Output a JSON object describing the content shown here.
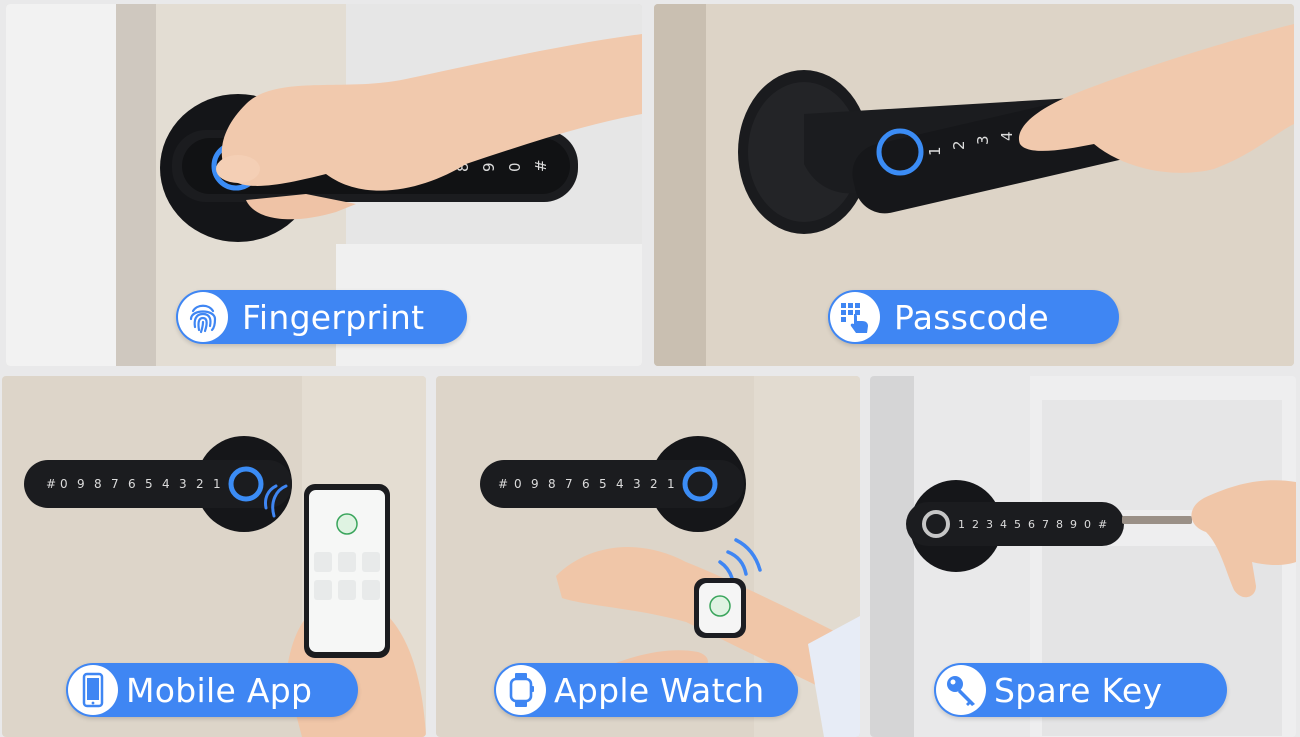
{
  "features": [
    {
      "label": "Fingerprint",
      "icon": "fingerprint-icon"
    },
    {
      "label": "Passcode",
      "icon": "keypad-tap-icon"
    },
    {
      "label": "Mobile App",
      "icon": "smartphone-icon"
    },
    {
      "label": "Apple Watch",
      "icon": "smartwatch-icon"
    },
    {
      "label": "Spare Key",
      "icon": "key-icon"
    }
  ],
  "keypad_digits": [
    "1",
    "2",
    "3",
    "4",
    "5",
    "6",
    "7",
    "8",
    "9",
    "0",
    "#"
  ],
  "colors": {
    "accent": "#3f86f3",
    "fingerprint_ring": "#3b8cf5",
    "lock_body": "#1b1c1f",
    "door_light": "#e8e1d6",
    "door_white": "#eeeeee"
  }
}
